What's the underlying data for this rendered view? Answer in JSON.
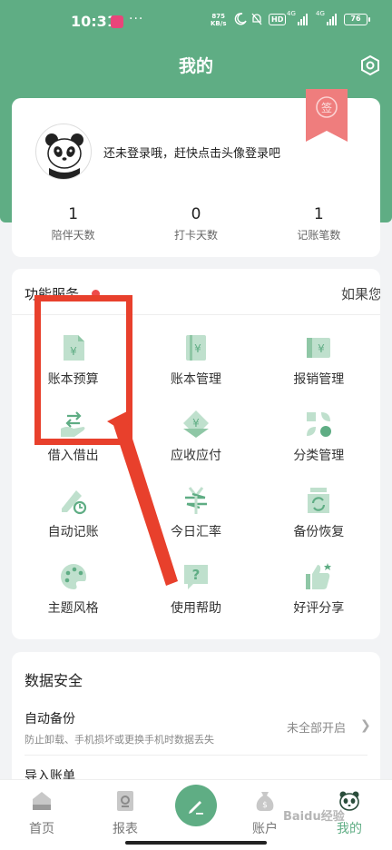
{
  "status_bar": {
    "time": "10:31",
    "more": "···",
    "speed_top": "875",
    "speed_unit": "KB/s",
    "hd": "HD",
    "network_1": "4G",
    "network_2": "4G",
    "battery": "76"
  },
  "header": {
    "title": "我的",
    "settings_icon": "settings-hex-icon"
  },
  "profile": {
    "login_prompt": "还未登录哦，赶快点击头像登录吧",
    "checkin_badge_text": "签",
    "stats": [
      {
        "value": "1",
        "label": "陪伴天数"
      },
      {
        "value": "0",
        "label": "打卡天数"
      },
      {
        "value": "1",
        "label": "记账笔数"
      }
    ]
  },
  "functions": {
    "title": "功能服务",
    "more_text": "如果您",
    "items": [
      {
        "label": "账本预算",
        "icon": "budget-book-icon"
      },
      {
        "label": "账本管理",
        "icon": "ledger-manage-icon"
      },
      {
        "label": "报销管理",
        "icon": "reimburse-icon"
      },
      {
        "label": "借入借出",
        "icon": "borrow-lend-icon"
      },
      {
        "label": "应收应付",
        "icon": "receivable-payable-icon"
      },
      {
        "label": "分类管理",
        "icon": "category-icon"
      },
      {
        "label": "自动记账",
        "icon": "auto-record-icon"
      },
      {
        "label": "今日汇率",
        "icon": "exchange-rate-icon"
      },
      {
        "label": "备份恢复",
        "icon": "backup-restore-icon"
      },
      {
        "label": "主题风格",
        "icon": "theme-palette-icon"
      },
      {
        "label": "使用帮助",
        "icon": "help-icon"
      },
      {
        "label": "好评分享",
        "icon": "thumbs-up-icon"
      }
    ]
  },
  "data_security": {
    "title": "数据安全",
    "auto_backup_title": "自动备份",
    "auto_backup_desc": "防止卸载、手机损坏或更换手机时数据丢失",
    "auto_backup_status": "未全部开启",
    "import_title": "导入账单"
  },
  "tabbar": {
    "tabs": [
      {
        "label": "首页"
      },
      {
        "label": "报表"
      },
      {
        "label": "账户"
      },
      {
        "label": "我的"
      }
    ]
  },
  "watermark": "Baidu经验",
  "colors": {
    "brand": "#5fad84",
    "icon_light": "#bfe0cd",
    "annotation_red": "#e8402c"
  }
}
